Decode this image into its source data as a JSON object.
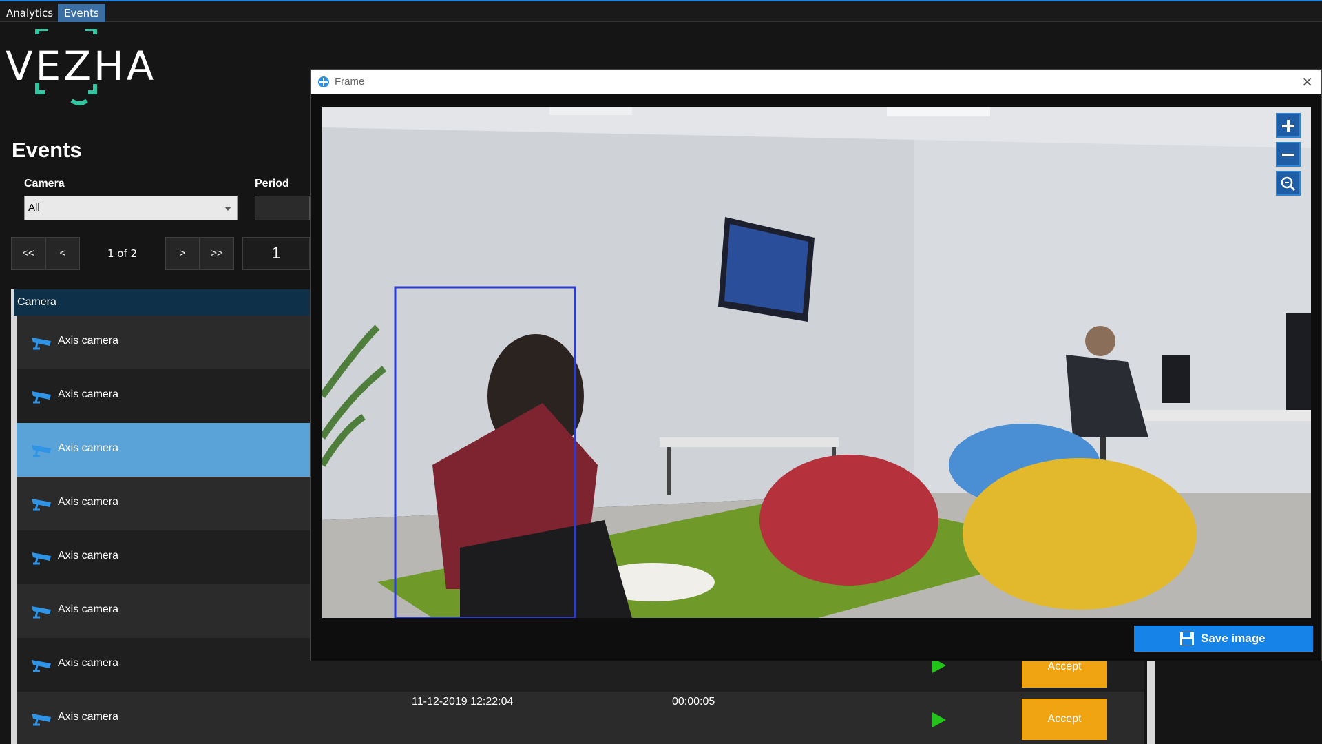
{
  "tabs": [
    {
      "label": "Analytics"
    },
    {
      "label": "Events"
    }
  ],
  "logo": {
    "text": "VEZHA"
  },
  "page": {
    "title": "Events"
  },
  "filters": {
    "camera_label": "Camera",
    "camera_value": "All",
    "period_label": "Period"
  },
  "pager": {
    "first": "<<",
    "prev": "<",
    "status": "1 of 2",
    "next": ">",
    "last": ">>",
    "page_input": "1"
  },
  "table": {
    "header": "Camera",
    "rows": [
      {
        "camera": "Axis camera"
      },
      {
        "camera": "Axis camera"
      },
      {
        "camera": "Axis camera"
      },
      {
        "camera": "Axis camera"
      },
      {
        "camera": "Axis camera"
      },
      {
        "camera": "Axis camera"
      },
      {
        "camera": "Axis camera",
        "action": "Accept"
      },
      {
        "camera": "Axis camera",
        "datetime": "11-12-2019 12:22:04",
        "duration": "00:00:05",
        "action": "Accept"
      }
    ],
    "selected_row": 3
  },
  "dialog": {
    "title": "Frame",
    "close_icon": "close-icon",
    "save_label": "Save image"
  },
  "zoom_controls": [
    "zoom-in-icon",
    "zoom-out-icon",
    "zoom-reset-icon"
  ],
  "colors": {
    "accent": "#1683e9",
    "selected_row": "#5aa3d8",
    "accept": "#f0a411",
    "play": "#23c41a",
    "header": "#0f3049",
    "bbox": "#2a3bd8"
  }
}
